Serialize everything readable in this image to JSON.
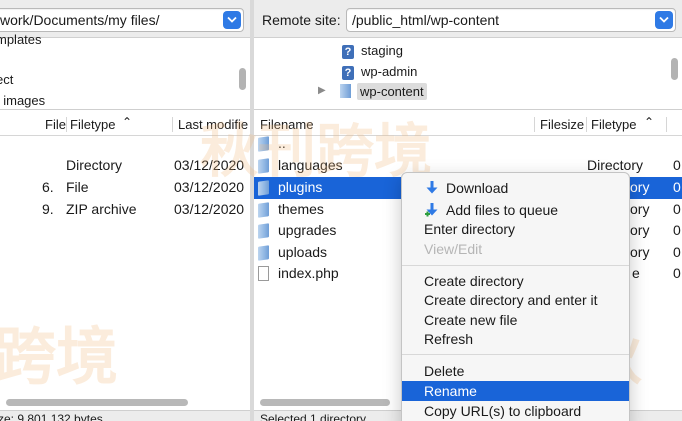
{
  "left": {
    "path": "work/Documents/my files/",
    "tree_items": [
      "mplates",
      "ect",
      "t images"
    ],
    "columns": [
      "File",
      "Filetype",
      "Last modifie"
    ],
    "sort_indicator": "^",
    "rows": [
      {
        "num": "",
        "type": "Directory",
        "date": "03/12/2020"
      },
      {
        "num": "6.",
        "type": "File",
        "date": "03/12/2020"
      },
      {
        "num": "9.",
        "type": "ZIP archive",
        "date": "03/12/2020"
      }
    ],
    "status": "ze: 9,801,132 bytes"
  },
  "right": {
    "label": "Remote site:",
    "path": "/public_html/wp-content",
    "tree_items": [
      "staging",
      "wp-admin",
      "wp-content"
    ],
    "columns": [
      "Filename",
      "Filesize",
      "Filetype"
    ],
    "sort_indicator": "^",
    "rows": [
      {
        "name": "..",
        "type": "",
        "extra": ""
      },
      {
        "name": "languages",
        "type": "Directory",
        "extra": "0"
      },
      {
        "name": "plugins",
        "type": "ory",
        "extra": "0"
      },
      {
        "name": "themes",
        "type": "ory",
        "extra": "0"
      },
      {
        "name": "upgrades",
        "type": "ory",
        "extra": "0"
      },
      {
        "name": "uploads",
        "type": "ory",
        "extra": "0"
      },
      {
        "name": "index.php",
        "type": "e",
        "extra": "0"
      }
    ],
    "status": "Selected 1 directory"
  },
  "context_menu": {
    "download": "Download",
    "add_to_queue": "Add files to queue",
    "enter_directory": "Enter directory",
    "view_edit": "View/Edit",
    "create_directory": "Create directory",
    "create_directory_enter": "Create directory and enter it",
    "create_new_file": "Create new file",
    "refresh": "Refresh",
    "delete": "Delete",
    "rename": "Rename",
    "copy_url": "Copy URL(s) to clipboard"
  },
  "colors": {
    "selection": "#1964d8",
    "accent": "#2f7ae5"
  },
  "icons": {
    "unknown_folder": "question-mark-icon",
    "folder": "folder-icon",
    "file": "file-icon"
  }
}
